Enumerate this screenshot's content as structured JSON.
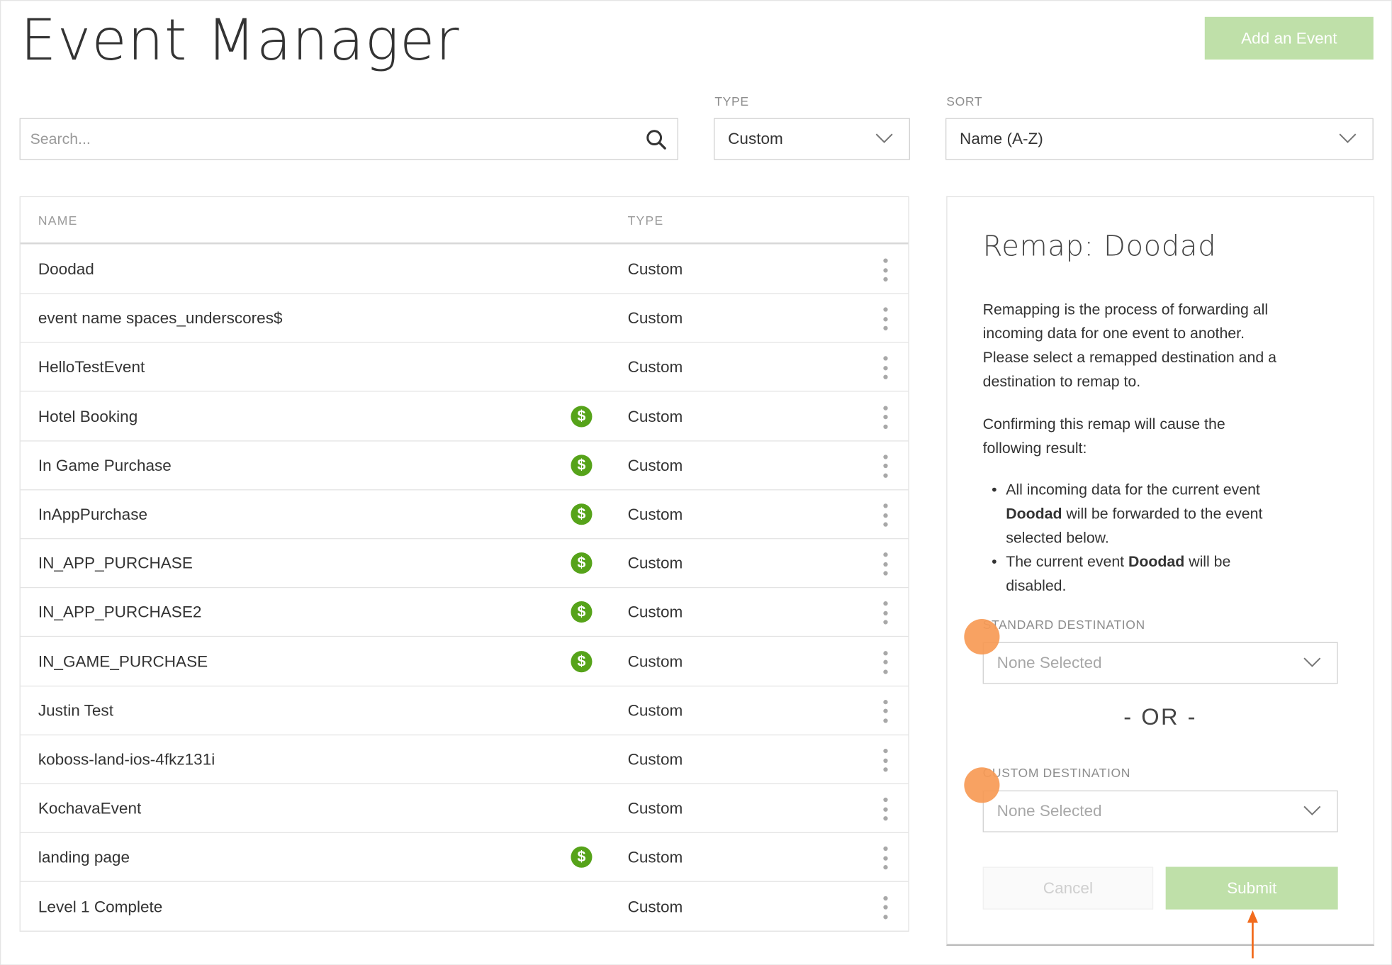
{
  "header": {
    "title": "Event Manager",
    "add_button": "Add an Event"
  },
  "filters": {
    "search_placeholder": "Search...",
    "search_icon": "search-icon",
    "type_label": "TYPE",
    "type_value": "Custom",
    "sort_label": "SORT",
    "sort_value": "Name (A-Z)"
  },
  "table": {
    "col_name": "NAME",
    "col_type": "TYPE",
    "rows": [
      {
        "name": "Doodad",
        "type": "Custom",
        "revenue": false
      },
      {
        "name": "event name spaces_underscores$",
        "type": "Custom",
        "revenue": false
      },
      {
        "name": "HelloTestEvent",
        "type": "Custom",
        "revenue": false
      },
      {
        "name": "Hotel Booking",
        "type": "Custom",
        "revenue": true
      },
      {
        "name": "In Game Purchase",
        "type": "Custom",
        "revenue": true
      },
      {
        "name": "InAppPurchase",
        "type": "Custom",
        "revenue": true
      },
      {
        "name": "IN_APP_PURCHASE",
        "type": "Custom",
        "revenue": true
      },
      {
        "name": "IN_APP_PURCHASE2",
        "type": "Custom",
        "revenue": true
      },
      {
        "name": "IN_GAME_PURCHASE",
        "type": "Custom",
        "revenue": true
      },
      {
        "name": "Justin Test",
        "type": "Custom",
        "revenue": false
      },
      {
        "name": "koboss-land-ios-4fkz131i",
        "type": "Custom",
        "revenue": false
      },
      {
        "name": "KochavaEvent",
        "type": "Custom",
        "revenue": false
      },
      {
        "name": "landing page",
        "type": "Custom",
        "revenue": true
      },
      {
        "name": "Level 1 Complete",
        "type": "Custom",
        "revenue": false
      }
    ],
    "revenue_symbol": "$"
  },
  "panel": {
    "title": "Remap: Doodad",
    "p1_l1": "Remapping is the process of forwarding all",
    "p1_l2": "incoming data for one event to another.",
    "p1_l3": "Please select a remapped destination and a",
    "p1_l4": "destination to remap to.",
    "p2_l1": "Confirming this remap will cause the",
    "p2_l2": "following result:",
    "b1_l1": "All incoming data for the current event",
    "b1_event": "Doodad",
    "b1_l2": " will be forwarded to the event",
    "b1_l3": "selected below.",
    "b2_l1": "The current event ",
    "b2_event": "Doodad",
    "b2_l1b": " will be",
    "b2_l2": "disabled.",
    "std_label": "STANDARD DESTINATION",
    "std_value": "None Selected",
    "or_text": "- OR -",
    "custom_label": "CUSTOM DESTINATION",
    "custom_value": "None Selected",
    "cancel": "Cancel",
    "submit": "Submit"
  },
  "colors": {
    "accent_green": "#bfe0a9",
    "revenue_green": "#56a31a",
    "marker_orange": "#f79a55"
  }
}
